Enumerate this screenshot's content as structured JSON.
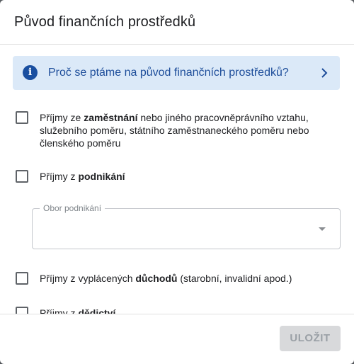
{
  "dialog": {
    "title": "Původ finančních prostředků",
    "info_banner": {
      "text": "Proč se ptáme na původ finančních prostředků?",
      "icon": "info-icon",
      "chevron": "chevron-right-icon"
    },
    "options": [
      {
        "pre": "Příjmy ze ",
        "bold": "zaměstnání",
        "post": " nebo jiného pracovněprávního vztahu, služebního poměru, státního zaměstnaneckého poměru nebo členského poměru",
        "checked": false
      },
      {
        "pre": "Příjmy z ",
        "bold": "podnikání",
        "post": "",
        "checked": false
      },
      {
        "pre": "Příjmy z vyplácených ",
        "bold": "důchodů",
        "post": " (starobní, invalidní apod.)",
        "checked": false
      },
      {
        "pre": "Příjmy z ",
        "bold": "dědictví",
        "post": "",
        "checked": false
      }
    ],
    "business_field": {
      "label": "Obor podnikání",
      "value": ""
    },
    "save_label": "ULOŽIT"
  },
  "colors": {
    "banner_bg": "#dbe9f8",
    "accent": "#1d4d9a",
    "disabled_button": "#d8d9db"
  }
}
